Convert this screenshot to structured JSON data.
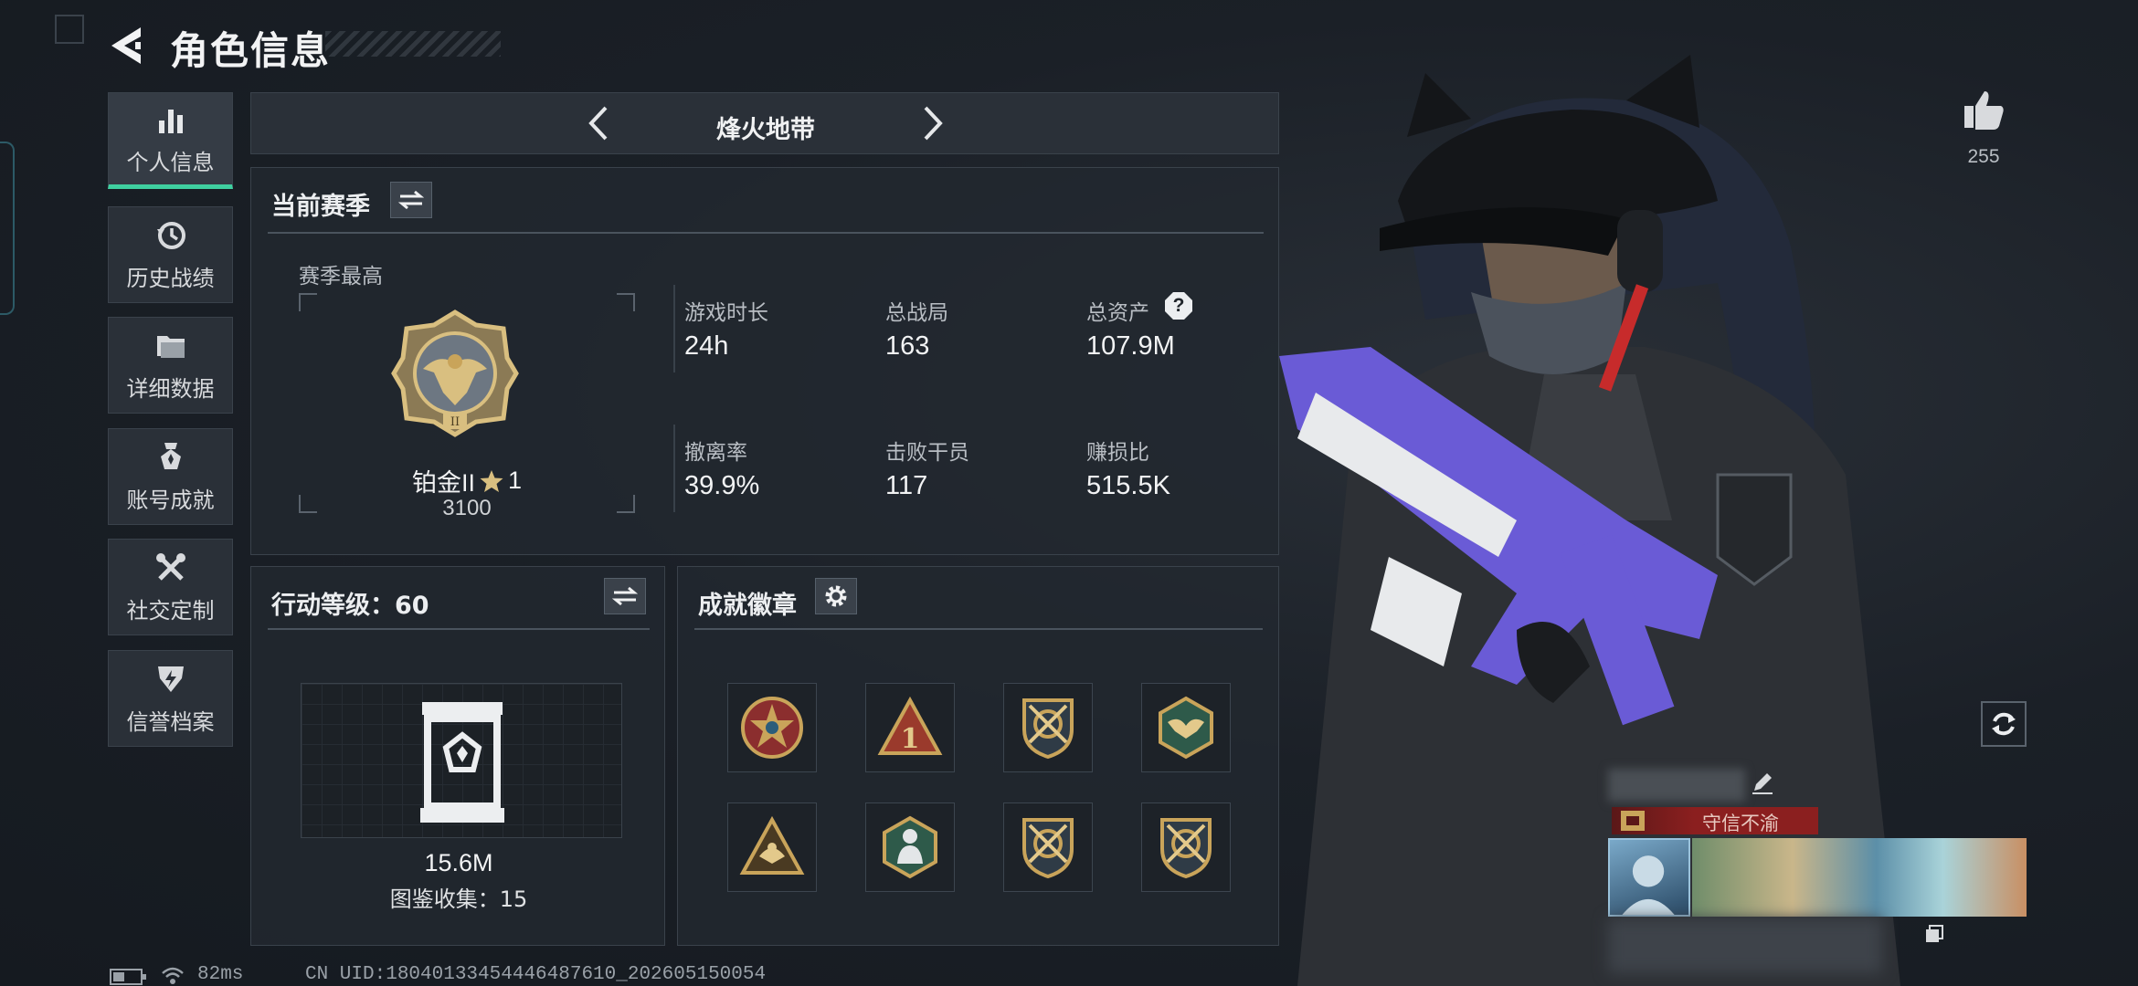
{
  "header": {
    "title": "角色信息"
  },
  "nav": [
    {
      "label": "个人信息",
      "icon": "bar-chart-icon",
      "active": true
    },
    {
      "label": "历史战绩",
      "icon": "history-clock-icon"
    },
    {
      "label": "详细数据",
      "icon": "folder-icon"
    },
    {
      "label": "账号成就",
      "icon": "medal-icon"
    },
    {
      "label": "社交定制",
      "icon": "tools-icon"
    },
    {
      "label": "信誉档案",
      "icon": "shield-bolt-icon"
    }
  ],
  "mode": {
    "label": "烽火地带"
  },
  "season": {
    "title": "当前赛季",
    "best_label": "赛季最高",
    "rank_name": "铂金II",
    "rank_stars": "1",
    "rank_points": "3100",
    "stats": [
      {
        "label": "游戏时长",
        "value": "24h"
      },
      {
        "label": "总战局",
        "value": "163"
      },
      {
        "label": "总资产",
        "value": "107.9M",
        "help": "?"
      },
      {
        "label": "撤离率",
        "value": "39.9%"
      },
      {
        "label": "击败干员",
        "value": "117"
      },
      {
        "label": "赚损比",
        "value": "515.5K"
      }
    ]
  },
  "action_level": {
    "title": "行动等级：60",
    "value": "15.6M",
    "collection_label": "图鉴收集：15"
  },
  "achievements": {
    "title": "成就徽章",
    "badges": [
      "star-badge-icon",
      "triangle-one-badge-icon",
      "crossed-arrows-shield-icon",
      "winged-hex-badge-icon",
      "triangle-eagle-badge-icon",
      "hex-figure-badge-icon",
      "crossed-arrows-shield-icon",
      "crossed-arrows-shield-icon"
    ]
  },
  "likes": {
    "count": "255"
  },
  "profile_card": {
    "tag": "守信不渝"
  },
  "status_bar": {
    "ping": "82ms",
    "uid": "CN UID:18040133454446487610_202605150054"
  },
  "colors": {
    "accent": "#3fd0a0",
    "gold": "#c9a45a",
    "tag_red": "#8b1f1f"
  }
}
